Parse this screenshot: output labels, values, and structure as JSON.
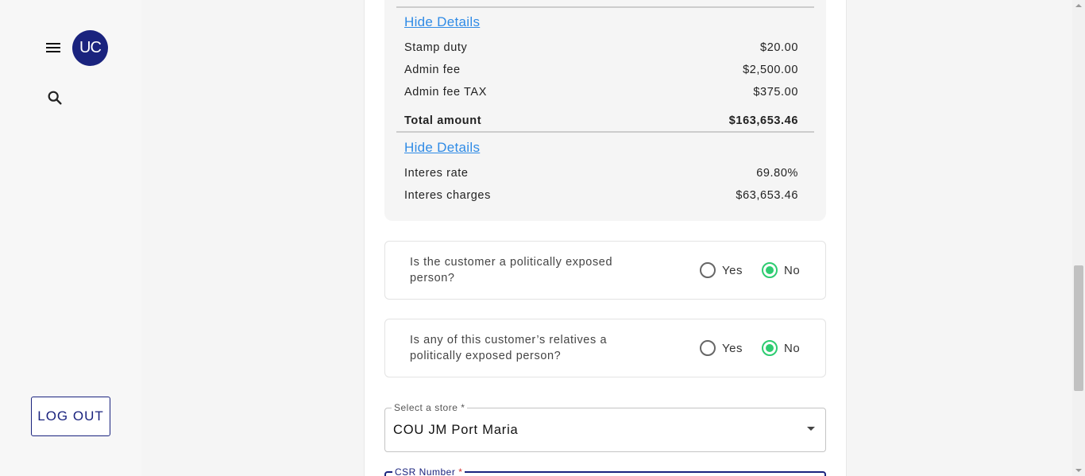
{
  "sidebar": {
    "avatar_initials": "UC",
    "logout_label": "LOG OUT",
    "menu_icon": "hamburger-menu-icon",
    "search_icon": "search-icon"
  },
  "summary": {
    "hide_details_1": "Hide Details",
    "fees": [
      {
        "label": "Stamp duty",
        "value": "$20.00"
      },
      {
        "label": "Admin fee",
        "value": "$2,500.00"
      },
      {
        "label": "Admin fee TAX",
        "value": "$375.00"
      }
    ],
    "total_label": "Total amount",
    "total_value": "$163,653.46",
    "hide_details_2": "Hide Details",
    "interest": [
      {
        "label": "Interes rate",
        "value": "69.80%"
      },
      {
        "label": "Interes charges",
        "value": "$63,653.46"
      }
    ]
  },
  "questions": [
    {
      "text": "Is the customer a politically exposed person?",
      "yes": "Yes",
      "no": "No",
      "selected": "No"
    },
    {
      "text": "Is any of this customer’s relatives a politically exposed person?",
      "yes": "Yes",
      "no": "No",
      "selected": "No"
    }
  ],
  "store_select": {
    "label": "Select a store *",
    "value": "COU JM Port Maria"
  },
  "csr": {
    "label": "CSR Number",
    "required_mark": "*"
  },
  "colors": {
    "brand": "#1a237e",
    "link": "#2f8be6",
    "radio_selected": "#2ecc71"
  }
}
